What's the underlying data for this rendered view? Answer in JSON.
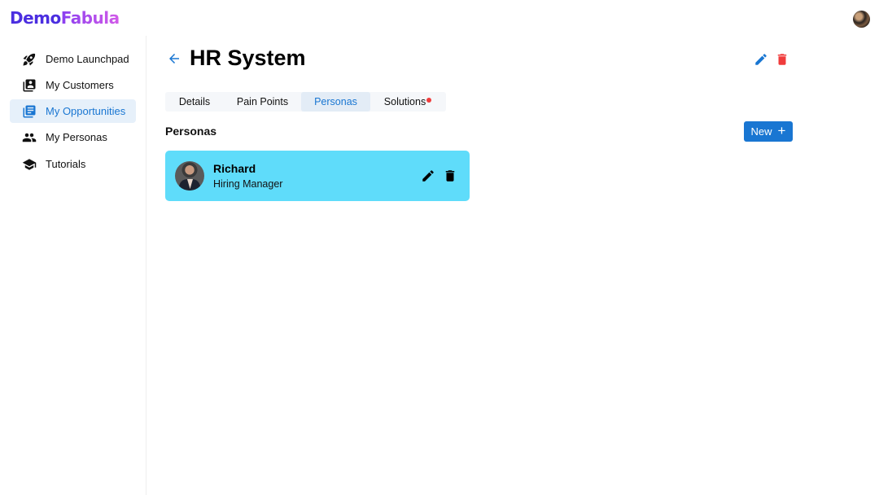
{
  "app": {
    "logo_part1": "Demo",
    "logo_part2": "Fabula"
  },
  "sidebar": {
    "items": [
      {
        "label": "Demo Launchpad",
        "icon": "rocket-icon",
        "active": false
      },
      {
        "label": "My Customers",
        "icon": "contacts-book-icon",
        "active": false
      },
      {
        "label": "My Opportunities",
        "icon": "library-books-icon",
        "active": true
      },
      {
        "label": "My Personas",
        "icon": "people-icon",
        "active": false
      },
      {
        "label": "Tutorials",
        "icon": "school-icon",
        "active": false
      }
    ]
  },
  "header": {
    "title": "HR System",
    "back_icon": "arrow-left-icon",
    "edit_icon": "pencil-icon",
    "delete_icon": "trash-icon"
  },
  "tabs": [
    {
      "label": "Details",
      "active": false
    },
    {
      "label": "Pain Points",
      "active": false
    },
    {
      "label": "Personas",
      "active": true
    },
    {
      "label": "Solutions",
      "active": false,
      "badge_dot": true
    }
  ],
  "section": {
    "title": "Personas",
    "new_button_label": "New",
    "new_button_icon": "+"
  },
  "personas": [
    {
      "name": "Richard",
      "role": "Hiring Manager"
    }
  ],
  "colors": {
    "accent": "#1976d2",
    "danger": "#f03c3c",
    "card": "#5fdcfa",
    "active_nav_bg": "#e6f0fa"
  }
}
